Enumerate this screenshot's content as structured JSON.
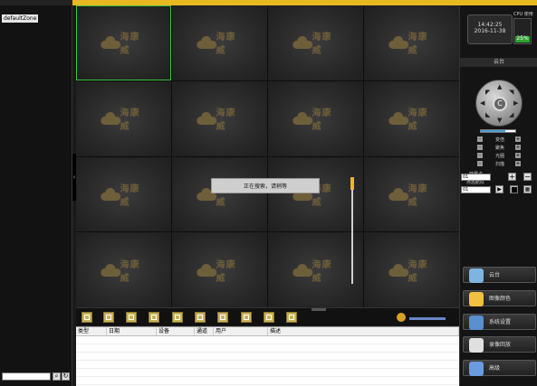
{
  "zone": {
    "name": "defaultZone"
  },
  "left": {
    "search_icon": "search-icon",
    "refresh_icon": "refresh-icon",
    "search_glyph": "⌕",
    "refresh_glyph": "↻"
  },
  "grid": {
    "logo_text": "海康威",
    "loading": "正在搜索，请稍等"
  },
  "table": {
    "columns": [
      "类型",
      "日期",
      "设备",
      "通道",
      "用户",
      "描述"
    ]
  },
  "right": {
    "clock_time": "14:42:25",
    "clock_date": "2016-11-38",
    "cpu_label": "CPU 使用率",
    "cpu_value": "25%",
    "cpu_fraction": 0.25,
    "ptz_title": "云台",
    "speed_fraction": 0.7,
    "controls": [
      "变倍",
      "聚焦",
      "光圈",
      "扫描"
    ],
    "preset_label": "转置点",
    "preset_value": "01",
    "cruise_label": "点巡航队",
    "cruise_value": "01",
    "buttons": [
      {
        "label": "云台",
        "color": "#7fb3e0"
      },
      {
        "label": "图像颜色",
        "color": "#f0c040"
      },
      {
        "label": "系统设置",
        "color": "#5a8fd0"
      },
      {
        "label": "录像回放",
        "color": "#e0e0e0"
      },
      {
        "label": "高级",
        "color": "#6a9be0"
      }
    ]
  },
  "colors": {
    "accent": "#e8b820",
    "selected_border": "#3ac43a"
  }
}
